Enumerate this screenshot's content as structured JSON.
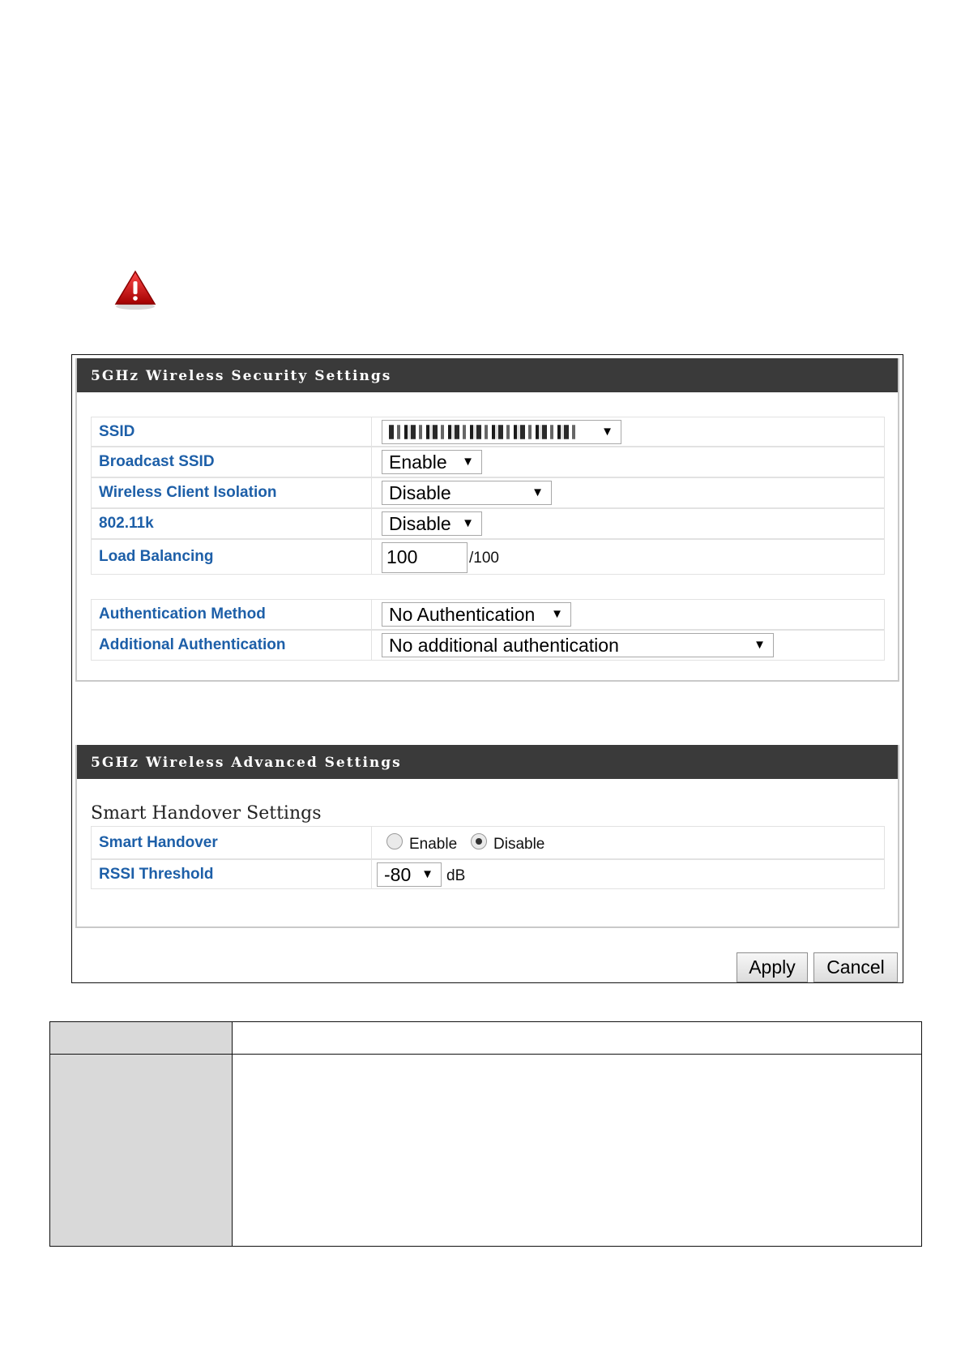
{
  "security": {
    "header": "5GHz Wireless Security Settings",
    "rows": [
      {
        "label": "SSID",
        "value": ""
      },
      {
        "label": "Broadcast SSID",
        "value": "Enable"
      },
      {
        "label": "Wireless Client Isolation",
        "value": "Disable"
      },
      {
        "label": "802.11k",
        "value": "Disable"
      },
      {
        "label": "Load Balancing",
        "value": "100",
        "unit": "/100"
      },
      {
        "label": "Authentication Method",
        "value": "No Authentication"
      },
      {
        "label": "Additional Authentication",
        "value": "No additional authentication"
      }
    ]
  },
  "advanced": {
    "header": "5GHz Wireless Advanced Settings",
    "subtitle": "Smart Handover Settings",
    "smart_handover": {
      "label": "Smart Handover",
      "options": [
        "Enable",
        "Disable"
      ],
      "selected": "Disable"
    },
    "rssi": {
      "label": "RSSI Threshold",
      "value": "-80",
      "unit": "dB"
    }
  },
  "buttons": {
    "apply": "Apply",
    "cancel": "Cancel"
  },
  "icons": {
    "warning": "warning-triangle-icon",
    "dropdown": "dropdown-arrow-icon"
  },
  "colors": {
    "label_blue": "#1d5fa8",
    "header_bg": "#3a3a3a",
    "warning_red": "#c8102e"
  }
}
